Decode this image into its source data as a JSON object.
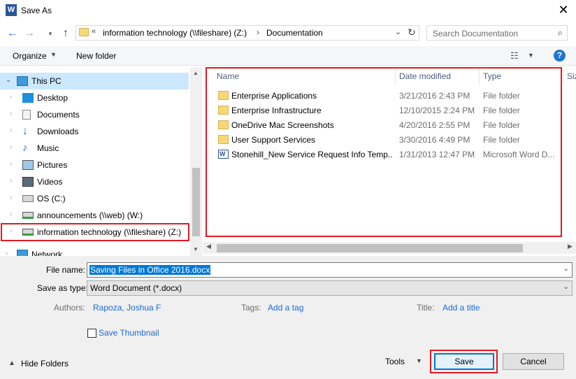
{
  "window": {
    "title": "Save As",
    "app_icon_letter": "W"
  },
  "nav": {
    "address_prefix": "«",
    "address_drive": "information technology (\\\\fileshare) (Z:)",
    "address_separator": "›",
    "address_folder": "Documentation",
    "search_placeholder": "Search Documentation"
  },
  "toolbar": {
    "organize_label": "Organize",
    "new_folder_label": "New folder",
    "help_label": "?"
  },
  "sidebar": {
    "items": [
      {
        "label": "This PC",
        "icon": "computer-icon"
      },
      {
        "label": "Desktop",
        "icon": "desktop-icon"
      },
      {
        "label": "Documents",
        "icon": "documents-icon"
      },
      {
        "label": "Downloads",
        "icon": "downloads-icon"
      },
      {
        "label": "Music",
        "icon": "music-icon"
      },
      {
        "label": "Pictures",
        "icon": "pictures-icon"
      },
      {
        "label": "Videos",
        "icon": "videos-icon"
      },
      {
        "label": "OS (C:)",
        "icon": "drive-icon"
      },
      {
        "label": "announcements (\\\\web) (W:)",
        "icon": "network-drive-icon"
      },
      {
        "label": "information technology (\\\\fileshare) (Z:)",
        "icon": "network-drive-icon"
      },
      {
        "label": "Network",
        "icon": "network-icon"
      }
    ]
  },
  "files": {
    "headers": {
      "name": "Name",
      "date": "Date modified",
      "type": "Type",
      "size": "Siz"
    },
    "rows": [
      {
        "name": "Enterprise Applications",
        "date": "3/21/2016 2:43 PM",
        "type": "File folder",
        "icon": "folder-icon"
      },
      {
        "name": "Enterprise Infrastructure",
        "date": "12/10/2015 2:24 PM",
        "type": "File folder",
        "icon": "folder-icon"
      },
      {
        "name": "OneDrive Mac Screenshots",
        "date": "4/20/2016 2:55 PM",
        "type": "File folder",
        "icon": "folder-icon"
      },
      {
        "name": "User Support Services",
        "date": "3/30/2016 4:49 PM",
        "type": "File folder",
        "icon": "folder-icon"
      },
      {
        "name": "Stonehill_New Service Request Info Temp...",
        "date": "1/31/2013 12:47 PM",
        "type": "Microsoft Word D...",
        "icon": "word-document-icon"
      }
    ]
  },
  "form": {
    "file_name_label": "File name:",
    "file_name_value": "Saving Files in Office 2016.docx",
    "save_type_label": "Save as type:",
    "save_type_value": "Word Document (*.docx)",
    "authors_label": "Authors:",
    "authors_value": "Rapoza, Joshua F",
    "tags_label": "Tags:",
    "tags_value": "Add a tag",
    "title_label": "Title:",
    "title_value": "Add a title",
    "thumbnail_label": "Save Thumbnail",
    "hide_folders_label": "Hide Folders",
    "tools_label": "Tools",
    "save_label": "Save",
    "cancel_label": "Cancel"
  },
  "colors": {
    "accent": "#0078d7",
    "highlight_box": "#e01b24",
    "link": "#1c6cd2",
    "selected_row": "#cce8ff"
  }
}
